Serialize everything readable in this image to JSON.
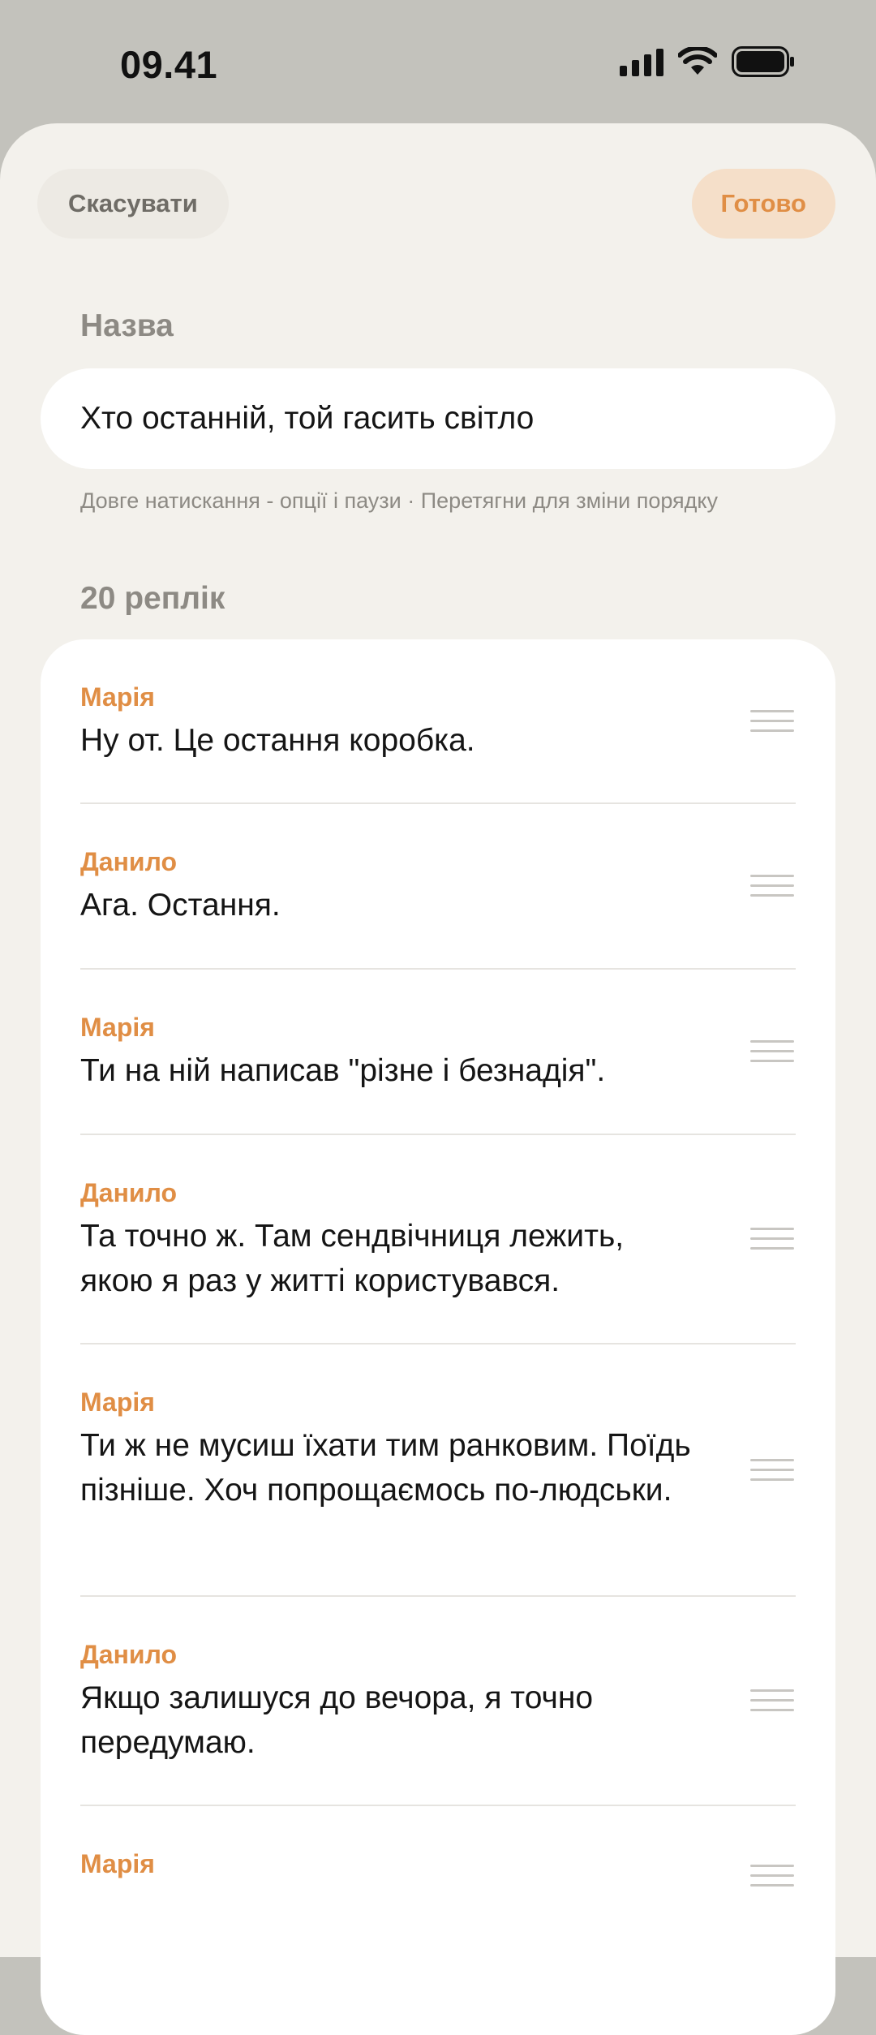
{
  "status": {
    "time": "09.41"
  },
  "header": {
    "cancel_label": "Скасувати",
    "done_label": "Готово"
  },
  "form": {
    "title_label": "Назва",
    "title_value": "Хто останній, той гасить світло",
    "hint": "Довге натискання - опції і паузи · Перетягни для зміни порядку",
    "count_label": "20 реплік"
  },
  "lines": [
    {
      "speaker": "Марія",
      "text": "Ну от. Це остання коробка."
    },
    {
      "speaker": "Данило",
      "text": "Ага. Остання."
    },
    {
      "speaker": "Марія",
      "text": "Ти на ній написав \"різне і безнадія\"."
    },
    {
      "speaker": "Данило",
      "text": "Та точно ж. Там сендвічниця лежить, якою я раз у житті користувався."
    },
    {
      "speaker": "Марія",
      "text": "Ти ж не мусиш їхати тим ранковим. Поїдь пізніше. Хоч попрощаємось по-людськи."
    },
    {
      "speaker": "Данило",
      "text": "Якщо залишуся до вечора, я точно передумаю."
    },
    {
      "speaker": "Марія",
      "text": ""
    }
  ],
  "colors": {
    "accent": "#e08e45",
    "sheet_bg": "#f3f1ec",
    "status_bg": "#c3c2bc"
  },
  "icons": {
    "signal": "cellular-signal-icon",
    "wifi": "wifi-icon",
    "battery": "battery-icon",
    "drag": "drag-handle-icon"
  }
}
